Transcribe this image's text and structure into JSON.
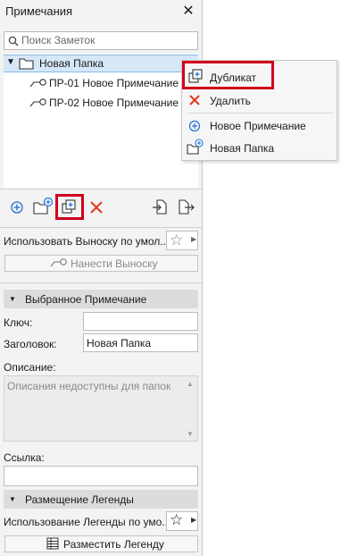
{
  "panel": {
    "title": "Примечания",
    "search_placeholder": "Поиск Заметок",
    "tree": {
      "folder": "Новая Папка",
      "notes": [
        "ПР-01 Новое Примечание",
        "ПР-02 Новое Примечание"
      ]
    },
    "callout_default": "Использовать Выноску по умол...",
    "apply_callout": "Нанести Выноску",
    "selected_note": {
      "header": "Выбранное Примечание",
      "key_label": "Ключ:",
      "key_value": "",
      "title_label": "Заголовок:",
      "title_value": "Новая Папка",
      "description_label": "Описание:",
      "description_placeholder": "Описания недоступны для папок",
      "link_label": "Ссылка:",
      "link_value": ""
    },
    "legend": {
      "header": "Размещение Легенды",
      "use_default": "Использование Легенды по умо...",
      "place_button": "Разместить Легенду"
    }
  },
  "context_menu": {
    "items": [
      "Дубликат",
      "Удалить",
      "Новое Примечание",
      "Новая Папка"
    ]
  },
  "colors": {
    "accent_blue": "#1e6fd9",
    "delete_red": "#e03a1e",
    "highlight_red": "#d0021b",
    "selection": "#d6e7f7"
  }
}
